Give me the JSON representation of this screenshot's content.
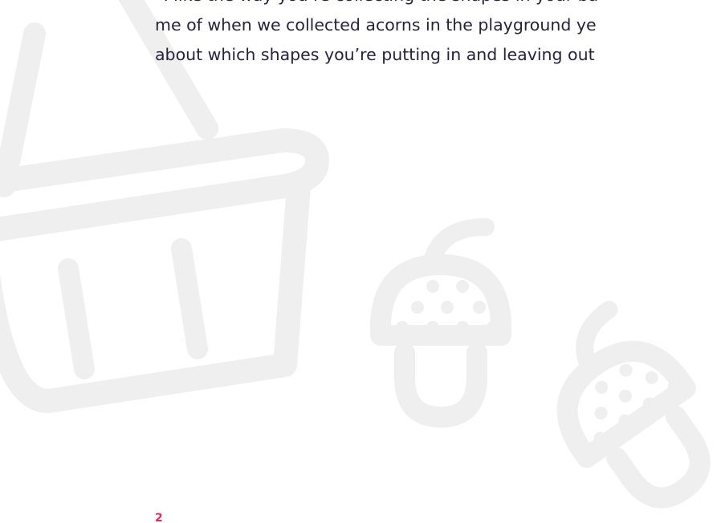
{
  "quote": {
    "lines": [
      "“I like the way you’re collecting the shapes in your ba",
      "me of when we collected acorns in the playground ye",
      "about which shapes you’re putting in and leaving out"
    ]
  },
  "page_number": "2",
  "colors": {
    "text": "#25233d",
    "accent": "#e5285a",
    "illustration": "#efefef"
  },
  "illustration": {
    "icons": [
      "basket-icon",
      "acorn-icon",
      "acorn-tilted-icon"
    ]
  }
}
